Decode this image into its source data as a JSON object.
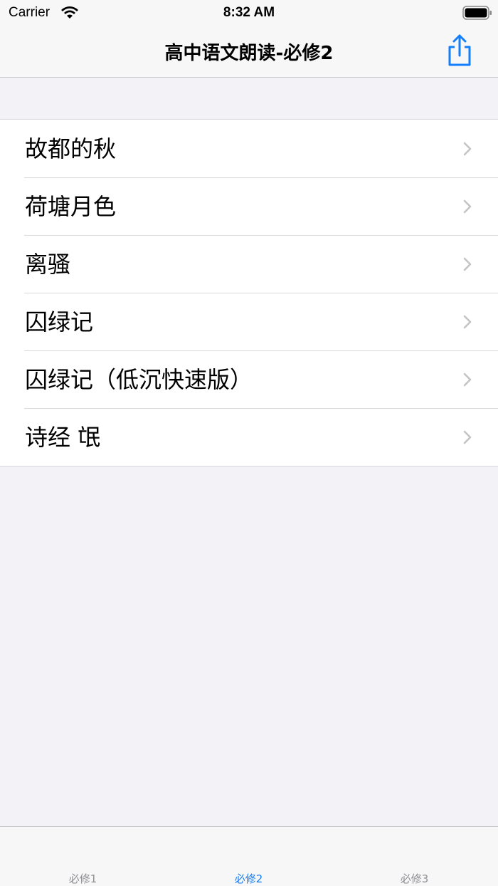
{
  "status_bar": {
    "carrier": "Carrier",
    "time": "8:32 AM"
  },
  "nav": {
    "title": "高中语文朗读-必修2",
    "share_icon": "share-icon",
    "accent": "#147EFB"
  },
  "list": {
    "items": [
      {
        "label": "故都的秋"
      },
      {
        "label": "荷塘月色"
      },
      {
        "label": "离骚"
      },
      {
        "label": "囚绿记"
      },
      {
        "label": "囚绿记（低沉快速版）"
      },
      {
        "label": "诗经 氓"
      }
    ]
  },
  "tabs": [
    {
      "label": "必修1",
      "active": false
    },
    {
      "label": "必修2",
      "active": true
    },
    {
      "label": "必修3",
      "active": false
    }
  ]
}
